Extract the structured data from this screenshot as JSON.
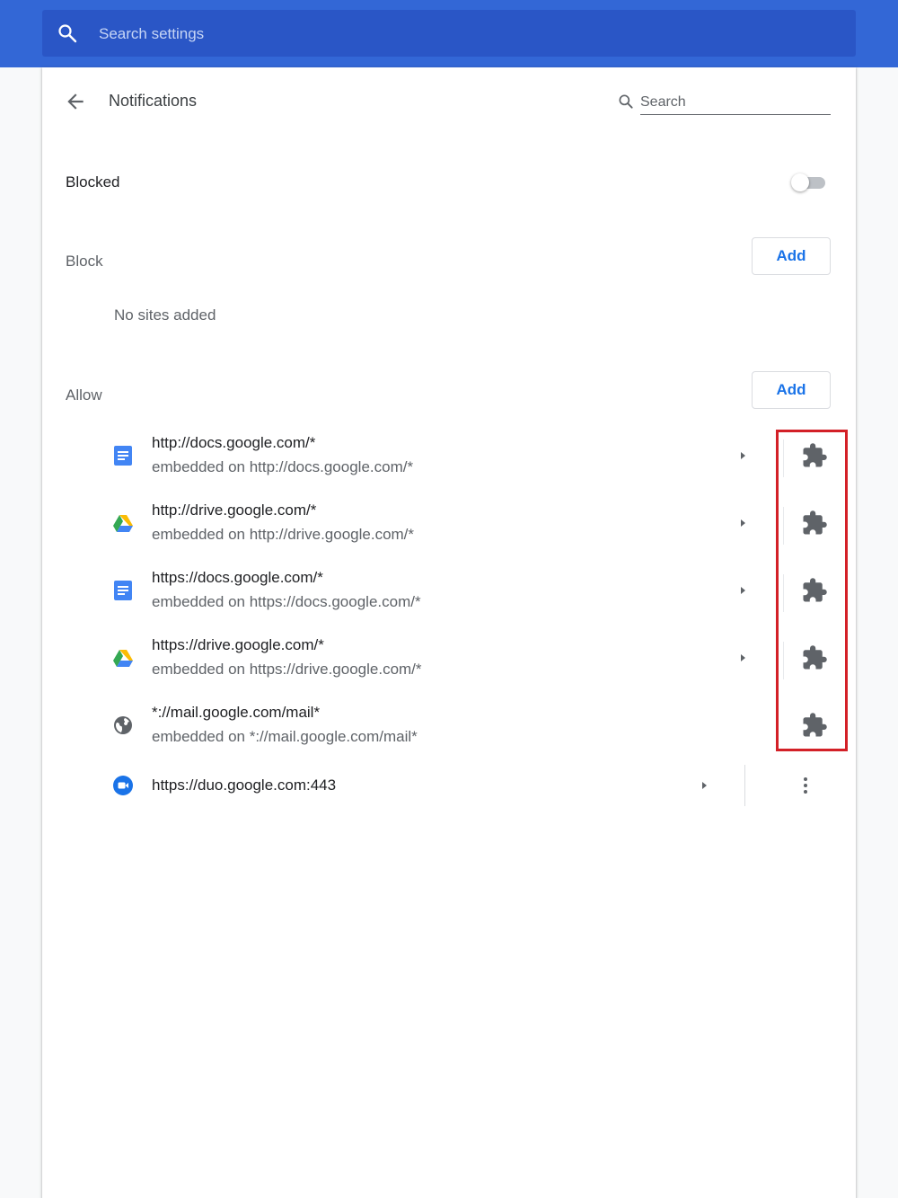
{
  "header": {
    "search_placeholder": "Search settings"
  },
  "page": {
    "title": "Notifications",
    "search_placeholder": "Search"
  },
  "blocked_row": {
    "label": "Blocked",
    "toggle_on": false
  },
  "block_section": {
    "label": "Block",
    "add_label": "Add",
    "empty_message": "No sites added"
  },
  "allow_section": {
    "label": "Allow",
    "add_label": "Add",
    "sites": [
      {
        "url": "http://docs.google.com/*",
        "embedded": "embedded on http://docs.google.com/*",
        "icon": "google-docs-icon",
        "action_icon": "puzzle-icon"
      },
      {
        "url": "http://drive.google.com/*",
        "embedded": "embedded on http://drive.google.com/*",
        "icon": "google-drive-icon",
        "action_icon": "puzzle-icon"
      },
      {
        "url": "https://docs.google.com/*",
        "embedded": "embedded on https://docs.google.com/*",
        "icon": "google-docs-icon",
        "action_icon": "puzzle-icon"
      },
      {
        "url": "https://drive.google.com/*",
        "embedded": "embedded on https://drive.google.com/*",
        "icon": "google-drive-icon",
        "action_icon": "puzzle-icon"
      },
      {
        "url": "*://mail.google.com/mail*",
        "embedded": "embedded on *://mail.google.com/mail*",
        "icon": "globe-icon",
        "action_icon": "puzzle-icon"
      },
      {
        "url": "https://duo.google.com:443",
        "icon": "google-duo-icon",
        "action_icon": "more-vert-icon"
      }
    ]
  },
  "colors": {
    "header_bg": "#3367d6",
    "search_bg": "#2a56c6",
    "accent": "#1a73e8",
    "highlight": "#d32027"
  }
}
